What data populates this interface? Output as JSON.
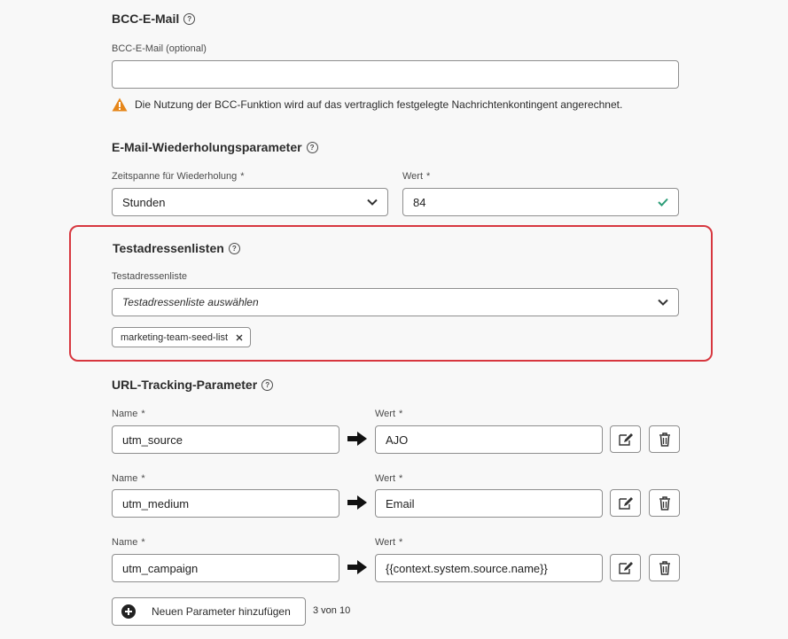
{
  "bcc": {
    "title": "BCC-E-Mail",
    "field_label": "BCC-E-Mail (optional)",
    "field_value": "",
    "warning": "Die Nutzung der BCC-Funktion wird auf das vertraglich festgelegte Nachrichtenkontingent angerechnet."
  },
  "retry": {
    "title": "E-Mail-Wiederholungsparameter",
    "period_label": "Zeitspanne für Wiederholung",
    "period_value": "Stunden",
    "value_label": "Wert",
    "value": "84"
  },
  "seedlists": {
    "title": "Testadressenlisten",
    "field_label": "Testadressenliste",
    "placeholder": "Testadressenliste auswählen",
    "tags": [
      "marketing-team-seed-list"
    ]
  },
  "tracking": {
    "title": "URL-Tracking-Parameter",
    "name_label": "Name",
    "value_label": "Wert",
    "params": [
      {
        "name": "utm_source",
        "value": "AJO"
      },
      {
        "name": "utm_medium",
        "value": "Email"
      },
      {
        "name": "utm_campaign",
        "value": "{{context.system.source.name}}"
      }
    ],
    "add_label": "Neuen Parameter hinzufügen",
    "count": "3 von 10"
  },
  "required_mark": "*",
  "colors": {
    "highlight_border": "#d7373f",
    "warning": "#e68619",
    "valid": "#2d9d78"
  }
}
